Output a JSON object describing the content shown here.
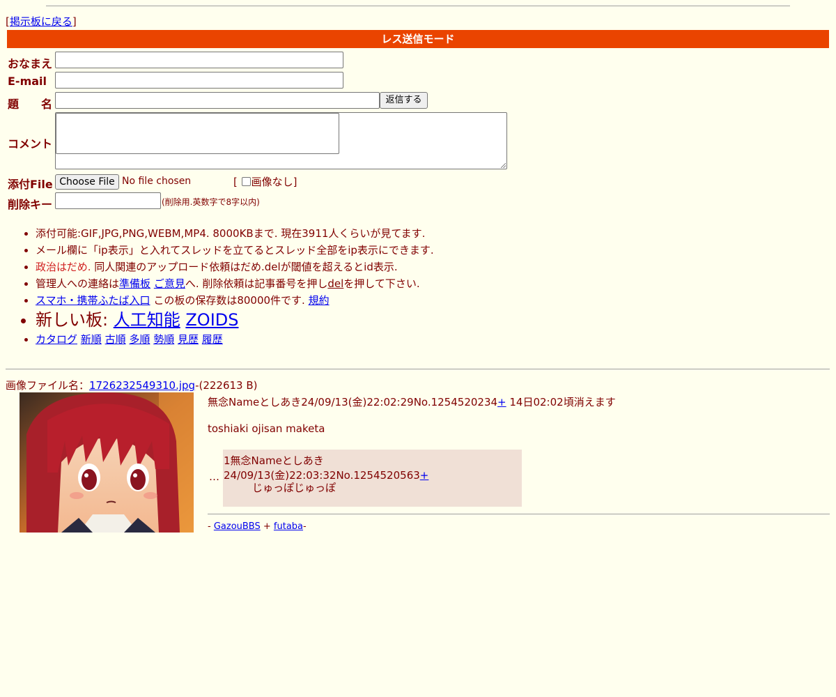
{
  "nav": {
    "back_prefix": "[",
    "back_label": "掲示板に戻る",
    "back_suffix": "]"
  },
  "form": {
    "mode_title": "レス送信モード",
    "name_label": "おなまえ",
    "email_label": "E-mail",
    "subject_label": "題　　名",
    "submit_label": "返信する",
    "comment_label": "コメント",
    "file_label": "添付File",
    "choose_file_label": "Choose File",
    "no_file_text": "No file chosen",
    "no_image_prefix": "[",
    "no_image_label": "画像なし",
    "no_image_suffix": "]",
    "delete_key_label": "削除キー",
    "delete_key_note": "(削除用.英数字で8字以内)"
  },
  "rules": {
    "r1": "添付可能:GIF,JPG,PNG,WEBM,MP4. 8000KBまで. 現在3911人くらいが見てます.",
    "r2": "メール欄に「ip表示」と入れてスレッドを立てるとスレッド全部をip表示にできます.",
    "r3_red": "政治はだめ.",
    "r3_rest": " 同人関連のアップロード依頼はだめ.delが閾値を超えるとid表示.",
    "r4_a": "管理人への連絡は",
    "r4_link1": "準備板",
    "r4_link2": "ご意見",
    "r4_b": "へ. 削除依頼は記事番号を押し",
    "r4_del": "del",
    "r4_c": "を押して下さい.",
    "r5_link": "スマホ・携帯ふたば入口",
    "r5_text": " この板の保存数は80000件です. ",
    "r5_link2": "規約",
    "r6_text": "新しい板: ",
    "r6_link1": "人工知能",
    "r6_link2": "ZOIDS",
    "r7_links": [
      "カタログ",
      "新順",
      "古順",
      "多順",
      "勢順",
      "見歴",
      "履歴"
    ]
  },
  "thread": {
    "file_prefix": "画像ファイル名：",
    "file_name": "1726232549310.jpg",
    "file_size": "-(222613 B)",
    "op_header": "無念Nameとしあき24/09/13(金)22:02:29No.1254520234",
    "op_plus": "+",
    "op_expire": " 14日02:02頃消えます",
    "op_comment": "toshiaki ojisan maketa",
    "ellipsis": "…",
    "reply_header": "1無念Nameとしあき24/09/13(金)22:03:32No.1254520563",
    "reply_plus": "+",
    "reply_comment": "じゅっぽじゅっぽ"
  },
  "footer": {
    "prefix": "- ",
    "link1": "GazouBBS",
    "sep": " + ",
    "link2": "futaba",
    "suffix": "-"
  }
}
